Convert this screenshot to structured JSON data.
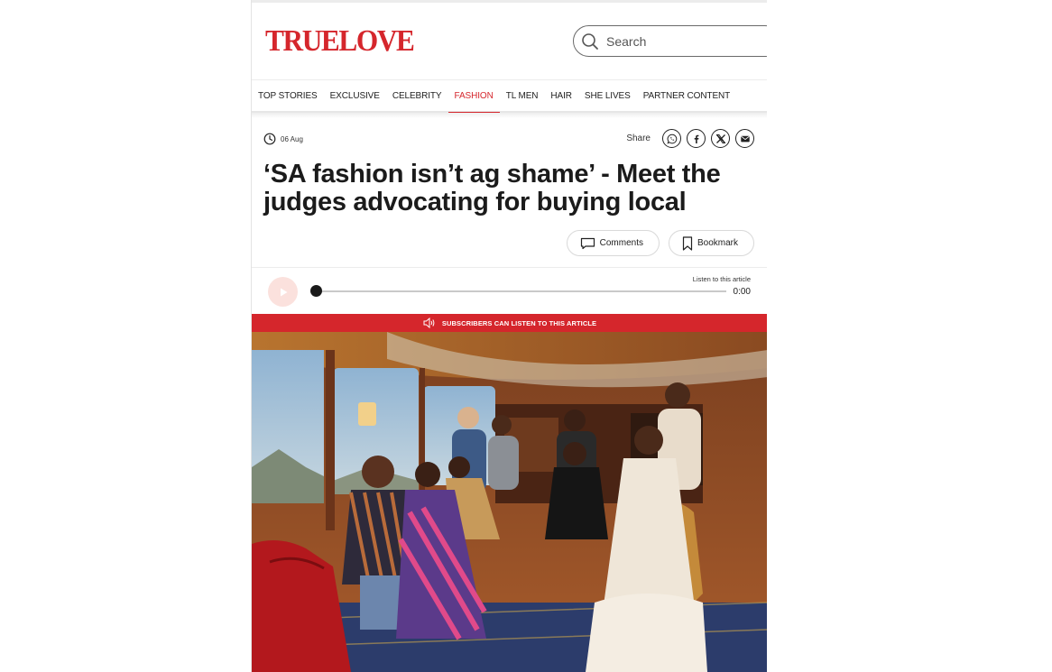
{
  "header": {
    "logo_text": "TRUELOVE",
    "search_placeholder": "Search"
  },
  "nav": {
    "items": [
      {
        "label": "TOP STORIES",
        "active": false
      },
      {
        "label": "EXCLUSIVE",
        "active": false
      },
      {
        "label": "CELEBRITY",
        "active": false
      },
      {
        "label": "FASHION",
        "active": true
      },
      {
        "label": "TL MEN",
        "active": false
      },
      {
        "label": "HAIR",
        "active": false
      },
      {
        "label": "SHE LIVES",
        "active": false
      },
      {
        "label": "PARTNER CONTENT",
        "active": false
      }
    ]
  },
  "article": {
    "date": "06 Aug",
    "share_label": "Share",
    "share_icons": [
      "whatsapp-icon",
      "facebook-icon",
      "x-icon",
      "email-icon"
    ],
    "headline": "‘SA fashion isn’t ag shame’ - Meet the judges advocating for buying local",
    "comments_label": "Comments",
    "bookmark_label": "Bookmark"
  },
  "player": {
    "listen_label": "Listen to this article",
    "time": "0:00",
    "progress": 0
  },
  "banner": {
    "text": "SUBSCRIBERS CAN LISTEN TO THIS ARTICLE"
  },
  "colors": {
    "brand": "#d5262c",
    "play_bg": "#fbe1dd"
  }
}
